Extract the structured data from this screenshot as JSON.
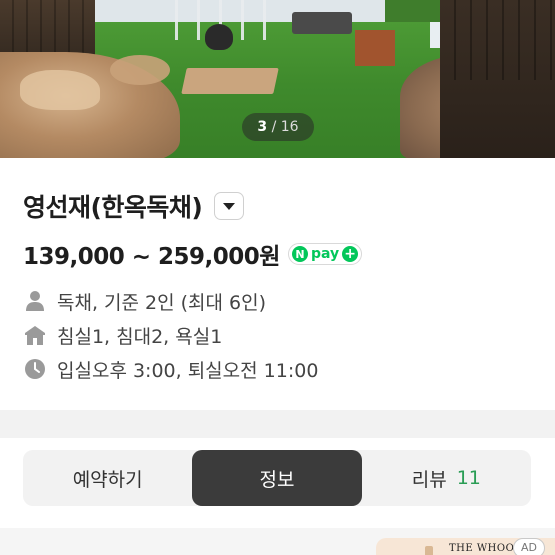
{
  "gallery": {
    "current": "3",
    "separator": " / ",
    "total": "16"
  },
  "listing": {
    "title": "영선재(한옥독채)",
    "price": "139,000 ~ 259,000원",
    "npay": {
      "n": "N",
      "label": "pay",
      "plus": "+"
    }
  },
  "details": {
    "guests": {
      "icon": "person-icon",
      "text": "독채, 기준 2인 (최대 6인)"
    },
    "rooms": {
      "icon": "house-icon",
      "text": "침실1, 침대2, 욕실1"
    },
    "time": {
      "icon": "clock-icon",
      "text": "입실오후 3:00, 퇴실오전 11:00"
    }
  },
  "tabs": [
    {
      "label": "예약하기",
      "active": false
    },
    {
      "label": "정보",
      "active": true
    },
    {
      "label": "리뷰",
      "count": "11",
      "active": false
    }
  ],
  "ad": {
    "brand": "THE WHOO",
    "badge": "AD"
  },
  "colors": {
    "npay_green": "#03c75a",
    "review_count": "#2a9d55",
    "active_tab": "#3b3b3b"
  }
}
